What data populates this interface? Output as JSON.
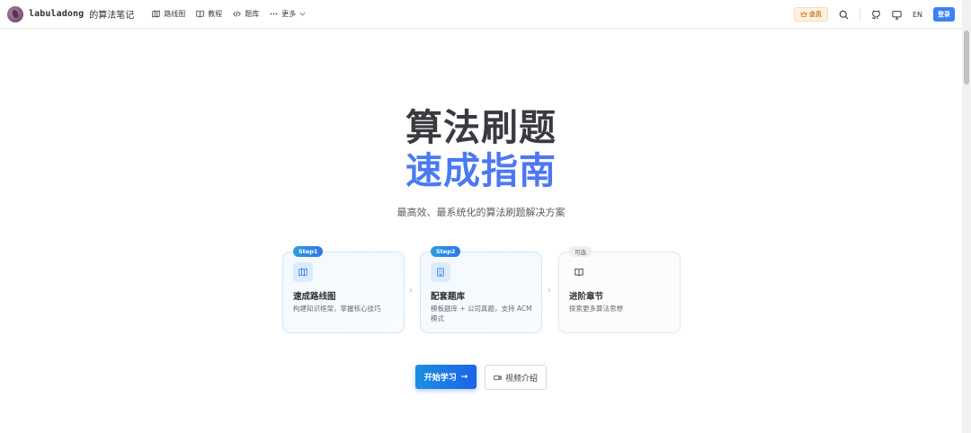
{
  "brand": {
    "name": "labuladong",
    "subtitle": "的算法笔记"
  },
  "nav": {
    "items": [
      {
        "label": "路线图",
        "icon": "map-icon"
      },
      {
        "label": "教程",
        "icon": "book-icon"
      },
      {
        "label": "题库",
        "icon": "code-icon"
      },
      {
        "label": "更多",
        "icon": "more-dots-icon"
      }
    ],
    "vip_label": "会员",
    "lang_label": "EN",
    "login_label": "登录"
  },
  "hero": {
    "title_line1": "算法刷题",
    "title_line2": "速成指南",
    "tagline": "最高效、最系统化的算法刷题解决方案"
  },
  "steps": [
    {
      "badge": "Step1",
      "title": "速成路线图",
      "desc": "构建知识框架，掌握核心技巧",
      "icon": "map-icon"
    },
    {
      "badge": "Step2",
      "title": "配套题库",
      "desc": "模板题库 + 公司真题，支持 ACM 模式",
      "icon": "building-icon"
    },
    {
      "badge": "可选",
      "title": "进阶章节",
      "desc": "探索更多算法思想",
      "icon": "open-book-icon"
    }
  ],
  "actions": {
    "start_label": "开始学习",
    "video_label": "视频介绍"
  },
  "colors": {
    "accent": "#3b82f6",
    "vip_bg": "#fdf1df",
    "vip_text": "#c7791c",
    "step_border": "#cfe6f6"
  }
}
